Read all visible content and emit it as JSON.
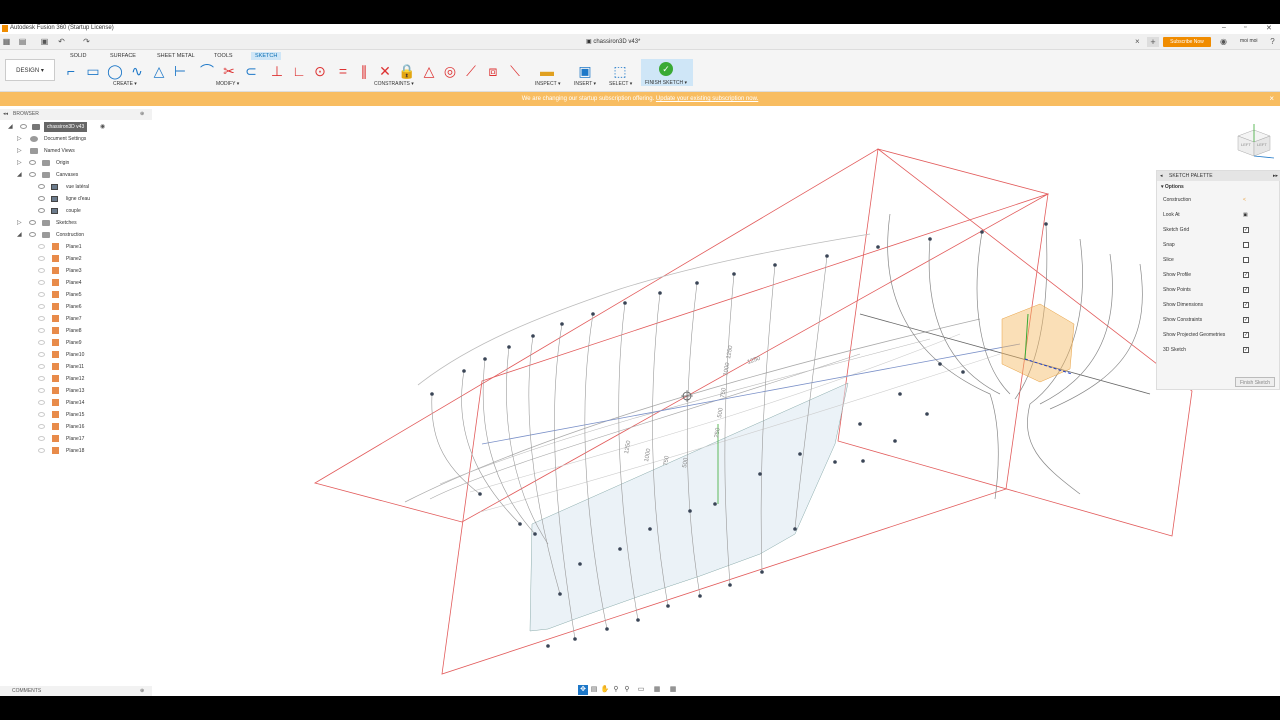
{
  "window": {
    "title": "Autodesk Fusion 360 (Startup License)"
  },
  "tabbar": {
    "document_tab": "chassiron3D v43*",
    "subscribe_label": "Subscribe Now",
    "user_label": "moi moi"
  },
  "toolbar": {
    "workspace_tabs": [
      "SOLID",
      "SURFACE",
      "SHEET METAL",
      "TOOLS",
      "SKETCH"
    ],
    "design_label": "DESIGN ▾",
    "groups": [
      "CREATE ▾",
      "MODIFY ▾",
      "CONSTRAINTS ▾",
      "INSPECT ▾",
      "INSERT ▾",
      "SELECT ▾"
    ],
    "finish_label": "FINISH SKETCH ▾"
  },
  "banner": {
    "text": "We are changing our startup subscription offering.",
    "link": "Update your existing subscription now."
  },
  "browser": {
    "header": "BROWSER",
    "root": "chassiron3D v43",
    "items": [
      "Document Settings",
      "Named Views",
      "Origin",
      "Canvases",
      "vue latéral",
      "ligne d'eau",
      "couple",
      "Sketches",
      "Construction"
    ],
    "planes": [
      "Plane1",
      "Plane2",
      "Plane3",
      "Plane4",
      "Plane5",
      "Plane6",
      "Plane7",
      "Plane8",
      "Plane9",
      "Plane10",
      "Plane11",
      "Plane12",
      "Plane13",
      "Plane14",
      "Plane15",
      "Plane16",
      "Plane17",
      "Plane18"
    ]
  },
  "comments": {
    "label": "COMMENTS"
  },
  "palette": {
    "header": "SKETCH PALETTE",
    "section": "Options",
    "rows": [
      "Construction",
      "Look At",
      "Sketch Grid",
      "Snap",
      "Slice",
      "Show Profile",
      "Show Points",
      "Show Dimensions",
      "Show Constraints",
      "Show Projected Geometries",
      "3D Sketch"
    ],
    "checked": [
      false,
      false,
      true,
      false,
      false,
      true,
      true,
      true,
      true,
      true,
      true
    ],
    "finish_button": "Finish Sketch"
  },
  "viewcube": {
    "face_left": "LEFT",
    "face_right": "LEFT"
  },
  "dimensions": [
    "1250",
    "1250",
    "1000",
    "750",
    "500",
    "250",
    "1250",
    "1000",
    "750",
    "500"
  ],
  "colors": {
    "accent": "#1e78c8",
    "banner": "#f8bd61",
    "construction_plane": "#e25b5b",
    "subscribe": "#f08c00"
  }
}
